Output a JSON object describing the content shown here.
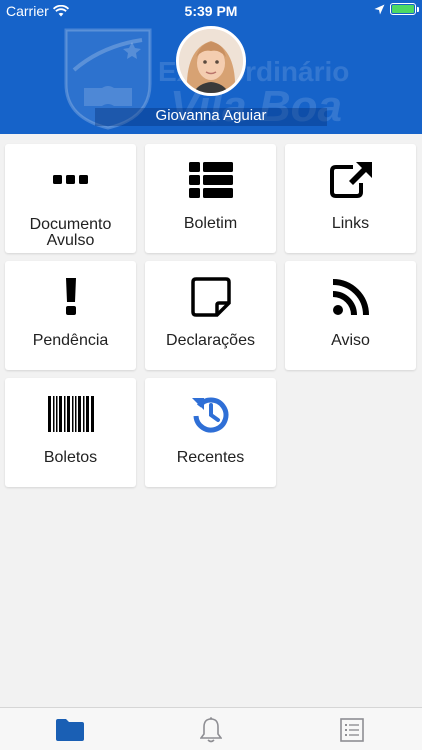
{
  "status_bar": {
    "carrier": "Carrier",
    "time": "5:39 PM"
  },
  "header": {
    "user_name": "Giovanna Aguiar",
    "watermark_line1": "Extraordinário",
    "watermark_line2": "Vila Boa"
  },
  "menu": [
    {
      "label": "Documento Avulso",
      "icon": "more-dots-icon"
    },
    {
      "label": "Boletim",
      "icon": "list-icon"
    },
    {
      "label": "Links",
      "icon": "external-link-icon"
    },
    {
      "label": "Pendência",
      "icon": "exclamation-icon"
    },
    {
      "label": "Declarações",
      "icon": "sticky-note-icon"
    },
    {
      "label": "Aviso",
      "icon": "rss-icon"
    },
    {
      "label": "Boletos",
      "icon": "barcode-icon"
    },
    {
      "label": "Recentes",
      "icon": "history-icon"
    }
  ],
  "tabbar": [
    {
      "icon": "folder-icon",
      "active": true
    },
    {
      "icon": "bell-icon",
      "active": false
    },
    {
      "icon": "list-icon",
      "active": false
    }
  ],
  "colors": {
    "header_bg": "#1663c9",
    "accent": "#1a5fb4",
    "history_icon": "#2f6fd6",
    "battery": "#4cd964"
  }
}
